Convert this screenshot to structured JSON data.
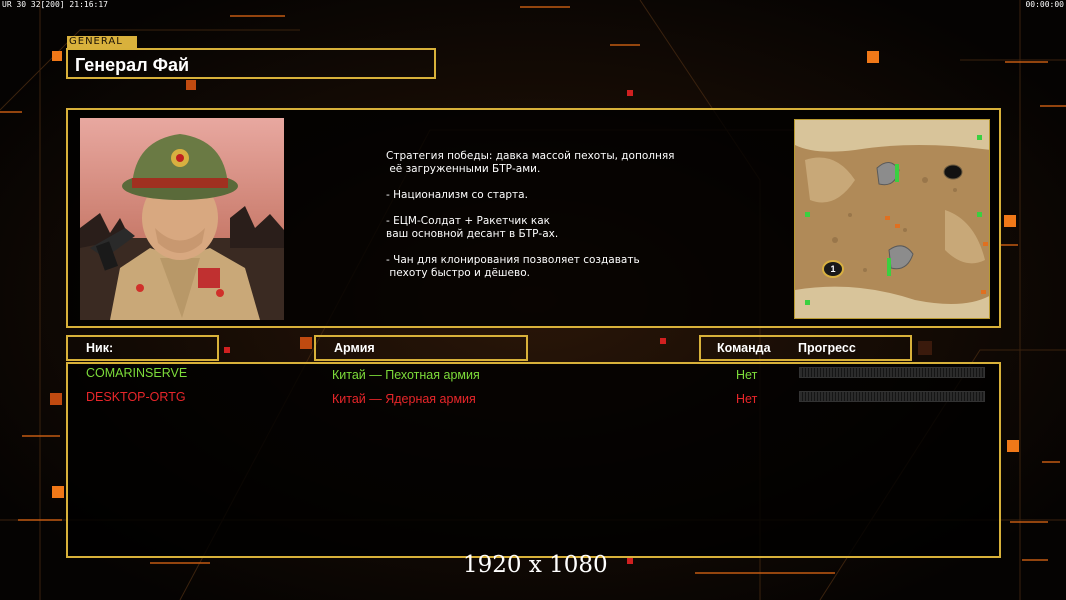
{
  "hud": {
    "left_text": "UR 30 32[200] 21:16:17",
    "right_text": "00:00:00"
  },
  "general": {
    "tag": "GENERAL",
    "name": "Генерал Фай"
  },
  "strategy": {
    "lines": [
      "Стратегия победы: давка массой пехоты, дополняя",
      " её загруженными БТР-ами.",
      "",
      "- Национализм со старта.",
      "",
      "- ЕЦМ-Солдат + Ракетчик как",
      "ваш основной десант в БТР-ах.",
      "",
      "- Чан для клонирования позволяет создавать",
      " пехоту быстро и дёшево."
    ]
  },
  "minimap": {
    "start_marker": "1"
  },
  "table": {
    "header_nick": "Ник:",
    "header_army": "Армия",
    "header_team": "Команда",
    "header_progress": "Прогресс",
    "rows": [
      {
        "nick": "COMARINSERVE",
        "army": "Китай — Пехотная армия",
        "team": "Нет",
        "color": "#7ddc3a",
        "progress": 0
      },
      {
        "nick": "DESKTOP-ORTG",
        "army": "Китай — Ядерная армия",
        "team": "Нет",
        "color": "#e8262a",
        "progress": 0
      }
    ]
  },
  "overlay": {
    "resolution": "1920 x 1080"
  },
  "colors": {
    "accent_gold": "#d8b13a",
    "accent_orange": "#f07818"
  }
}
